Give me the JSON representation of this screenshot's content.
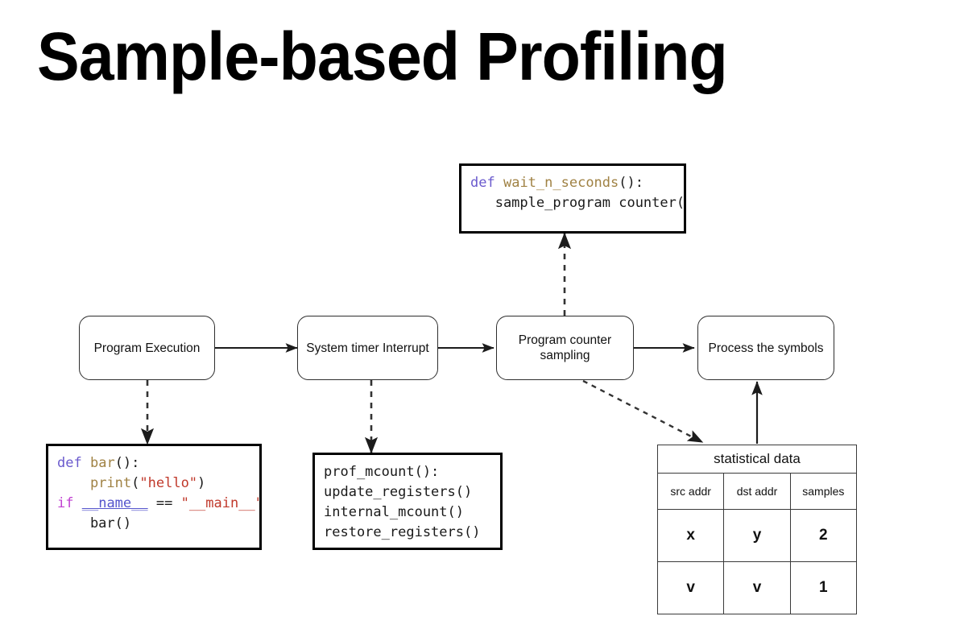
{
  "title": "Sample-based Profiling",
  "flow": {
    "boxes": [
      {
        "id": "program-execution",
        "label": "Program Execution"
      },
      {
        "id": "system-timer",
        "label": "System timer Interrupt"
      },
      {
        "id": "pc-sampling",
        "label": "Program counter sampling"
      },
      {
        "id": "process-symbols",
        "label": "Process the symbols"
      }
    ]
  },
  "code_blocks": {
    "wait_n_seconds": {
      "name": "wait-n-seconds-code",
      "lines": [
        [
          {
            "t": "def",
            "c": "kw"
          },
          {
            "t": " ",
            "c": "plain"
          },
          {
            "t": "wait_n_seconds",
            "c": "fn"
          },
          {
            "t": "():",
            "c": "plain"
          }
        ],
        [
          {
            "t": "   sample_program counter()",
            "c": "plain"
          }
        ]
      ]
    },
    "bar_function": {
      "name": "bar-function-code",
      "lines": [
        [
          {
            "t": "def",
            "c": "kw"
          },
          {
            "t": " ",
            "c": "plain"
          },
          {
            "t": "bar",
            "c": "fn"
          },
          {
            "t": "():",
            "c": "plain"
          }
        ],
        [
          {
            "t": "    ",
            "c": "plain"
          },
          {
            "t": "print",
            "c": "fn"
          },
          {
            "t": "(",
            "c": "plain"
          },
          {
            "t": "\"hello\"",
            "c": "str"
          },
          {
            "t": ")",
            "c": "plain"
          }
        ],
        [
          {
            "t": "if",
            "c": "kw2"
          },
          {
            "t": " ",
            "c": "plain"
          },
          {
            "t": "__name__",
            "c": "var"
          },
          {
            "t": " == ",
            "c": "plain"
          },
          {
            "t": "\"__main__\"",
            "c": "strmain"
          },
          {
            "t": ":",
            "c": "plain"
          }
        ],
        [
          {
            "t": "    bar()",
            "c": "plain"
          }
        ]
      ]
    },
    "mcount": {
      "name": "mcount-code",
      "lines": [
        [
          {
            "t": "prof_mcount():",
            "c": "plain"
          }
        ],
        [
          {
            "t": "update_registers()",
            "c": "plain"
          }
        ],
        [
          {
            "t": "internal_mcount()",
            "c": "plain"
          }
        ],
        [
          {
            "t": "restore_registers()",
            "c": "plain"
          }
        ]
      ]
    }
  },
  "stat_table": {
    "title": "statistical data",
    "columns": [
      "src addr",
      "dst addr",
      "samples"
    ],
    "rows": [
      [
        "x",
        "y",
        "2"
      ],
      [
        "v",
        "v",
        "1"
      ]
    ]
  },
  "colors": {
    "background": "#ffffff",
    "text": "#000000",
    "box_stroke": "#2e2e2e",
    "code_stroke": "#000000",
    "keyword": "#6a5acd",
    "keyword_if": "#c040d0",
    "function": "#a08244",
    "string": "#c0392b",
    "variable": "#5555cc",
    "connector": "#3a3a3a"
  }
}
